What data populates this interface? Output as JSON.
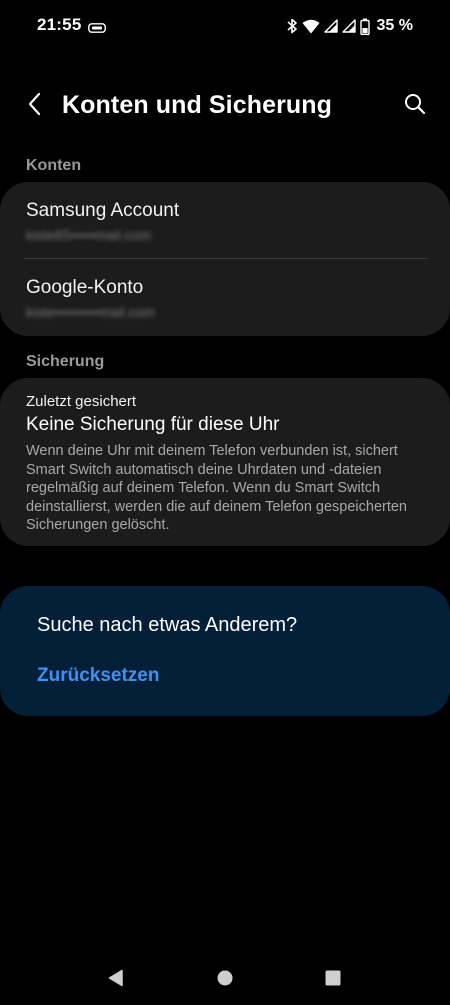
{
  "status_bar": {
    "time": "21:55",
    "notification_icon": "gesture-nav-icon",
    "icons": [
      "bluetooth-icon",
      "wifi-icon",
      "cell-signal-icon",
      "cell-signal-icon",
      "battery-icon"
    ],
    "battery_percent": "35 %"
  },
  "app_bar": {
    "back_icon": "chevron-left-icon",
    "title": "Konten und Sicherung",
    "search_icon": "search-icon"
  },
  "accounts_section": {
    "header": "Konten",
    "items": [
      {
        "name": "Samsung Account",
        "email": "kiste65•••••mail.com"
      },
      {
        "name": "Google-Konto",
        "email": "kiste•••••••••mail.com"
      }
    ]
  },
  "backup_section": {
    "header": "Sicherung",
    "label": "Zuletzt gesichert",
    "title": "Keine Sicherung für diese Uhr",
    "description": "Wenn deine Uhr mit deinem Telefon verbunden ist, sichert Smart Switch automatisch deine Uhrdaten und -dateien regelmäßig auf deinem Telefon. Wenn du Smart Switch deinstallierst, werden die auf deinem Telefon gespeicherten Sicherungen gelöscht."
  },
  "search_suggestion": {
    "prompt": "Suche nach etwas Anderem?",
    "reset_label": "Zurücksetzen"
  },
  "nav_bar": {
    "buttons": [
      "back-triangle-icon",
      "home-circle-icon",
      "recents-square-icon"
    ]
  },
  "colors": {
    "background": "#000000",
    "card": "#1c1c1c",
    "search_card": "#042038",
    "accent": "#3e91f2",
    "secondary_text": "#9a9a9a"
  }
}
